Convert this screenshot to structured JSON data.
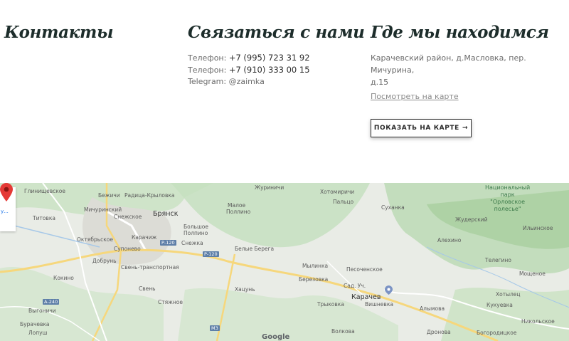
{
  "contacts": {
    "title": "Контакты"
  },
  "connect": {
    "title": "Связаться с нами",
    "phone1_label": "Телефон:",
    "phone1_value": "+7 (995) 723 31 92",
    "phone2_label": "Телефон:",
    "phone2_value": "+7 (910) 333 00 15",
    "telegram": "Telegram: @zaimka"
  },
  "location": {
    "title": "Где мы находимся",
    "address_line1": "Карачевский район, д.Масловка, пер. Мичурина,",
    "address_line2": "д.15",
    "map_link": "Посмотреть на карте",
    "show_button": "ПОКАЗАТЬ НА КАРТЕ",
    "show_button_arrow": "→"
  },
  "map": {
    "card_text": "у...",
    "google": "Google",
    "roads": [
      "Р-120",
      "Р-120",
      "А-240",
      "М3"
    ],
    "park": [
      "Национальный",
      "парк",
      "\"Орловское",
      "полесье\""
    ],
    "labels": [
      "Глинищевское",
      "Бежичи",
      "Радица-Крыловка",
      "Журиничи",
      "Хотомиричи",
      "Мичуринский",
      "Снежское",
      "Брянск",
      "Малое",
      "Поллино",
      "Пальцо",
      "Суханка",
      "Титовка",
      "Большое",
      "Полпино",
      "Жудерский",
      "Ильинское",
      "Октябрьское",
      "Карачиж",
      "Снежка",
      "Алехино",
      "Супонево",
      "Белые Берега",
      "Добрунь",
      "Свень-транспортная",
      "Мылинка",
      "Песоченское",
      "Телегино",
      "Мощеное",
      "Кокино",
      "Березовка",
      "Свень",
      "Хацунь",
      "Сад. Уч.",
      "Хотылец",
      "Стяжное",
      "Карачев",
      "Вишневка",
      "Алымова",
      "Кукуевка",
      "Выгоничи",
      "Трыковка",
      "Никольское",
      "Бурачевка",
      "Лопуш",
      "Волкова",
      "Дронова",
      "Богородицкое"
    ]
  }
}
